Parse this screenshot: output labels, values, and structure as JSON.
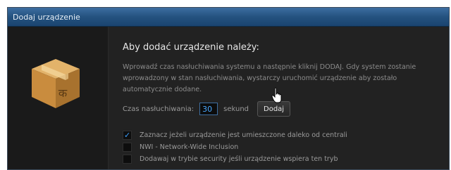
{
  "window": {
    "title": "Dodaj urządzenie"
  },
  "main": {
    "heading": "Aby dodać urządzenie należy:",
    "description": "Wprowadź czas nasłuchiwania systemu a następnie kliknij DODAJ. Gdy system zostanie wprowadzony w stan nasłuchiwania, wystarczy uruchomić urządzenie aby zostało automatycznie dodane.",
    "time_label": "Czas nasłuchiwania:",
    "time_value": "30",
    "time_unit": "sekund",
    "add_button": "Dodaj"
  },
  "options": [
    {
      "label": "Zaznacz jeżeli urządzenie jest umieszczone daleko od centrali",
      "checked": true
    },
    {
      "label": "NWI - Network-Wide Inclusion",
      "checked": false
    },
    {
      "label": "Dodawaj w trybie security jeśli urządzenie wspiera ten tryb",
      "checked": false
    }
  ],
  "colors": {
    "accent": "#3aa0ff",
    "titlebar": "#2a5a8a"
  },
  "icons": {
    "illustration": "package-box-icon",
    "cursor": "hand-pointer-icon",
    "check": "checkmark-icon"
  }
}
